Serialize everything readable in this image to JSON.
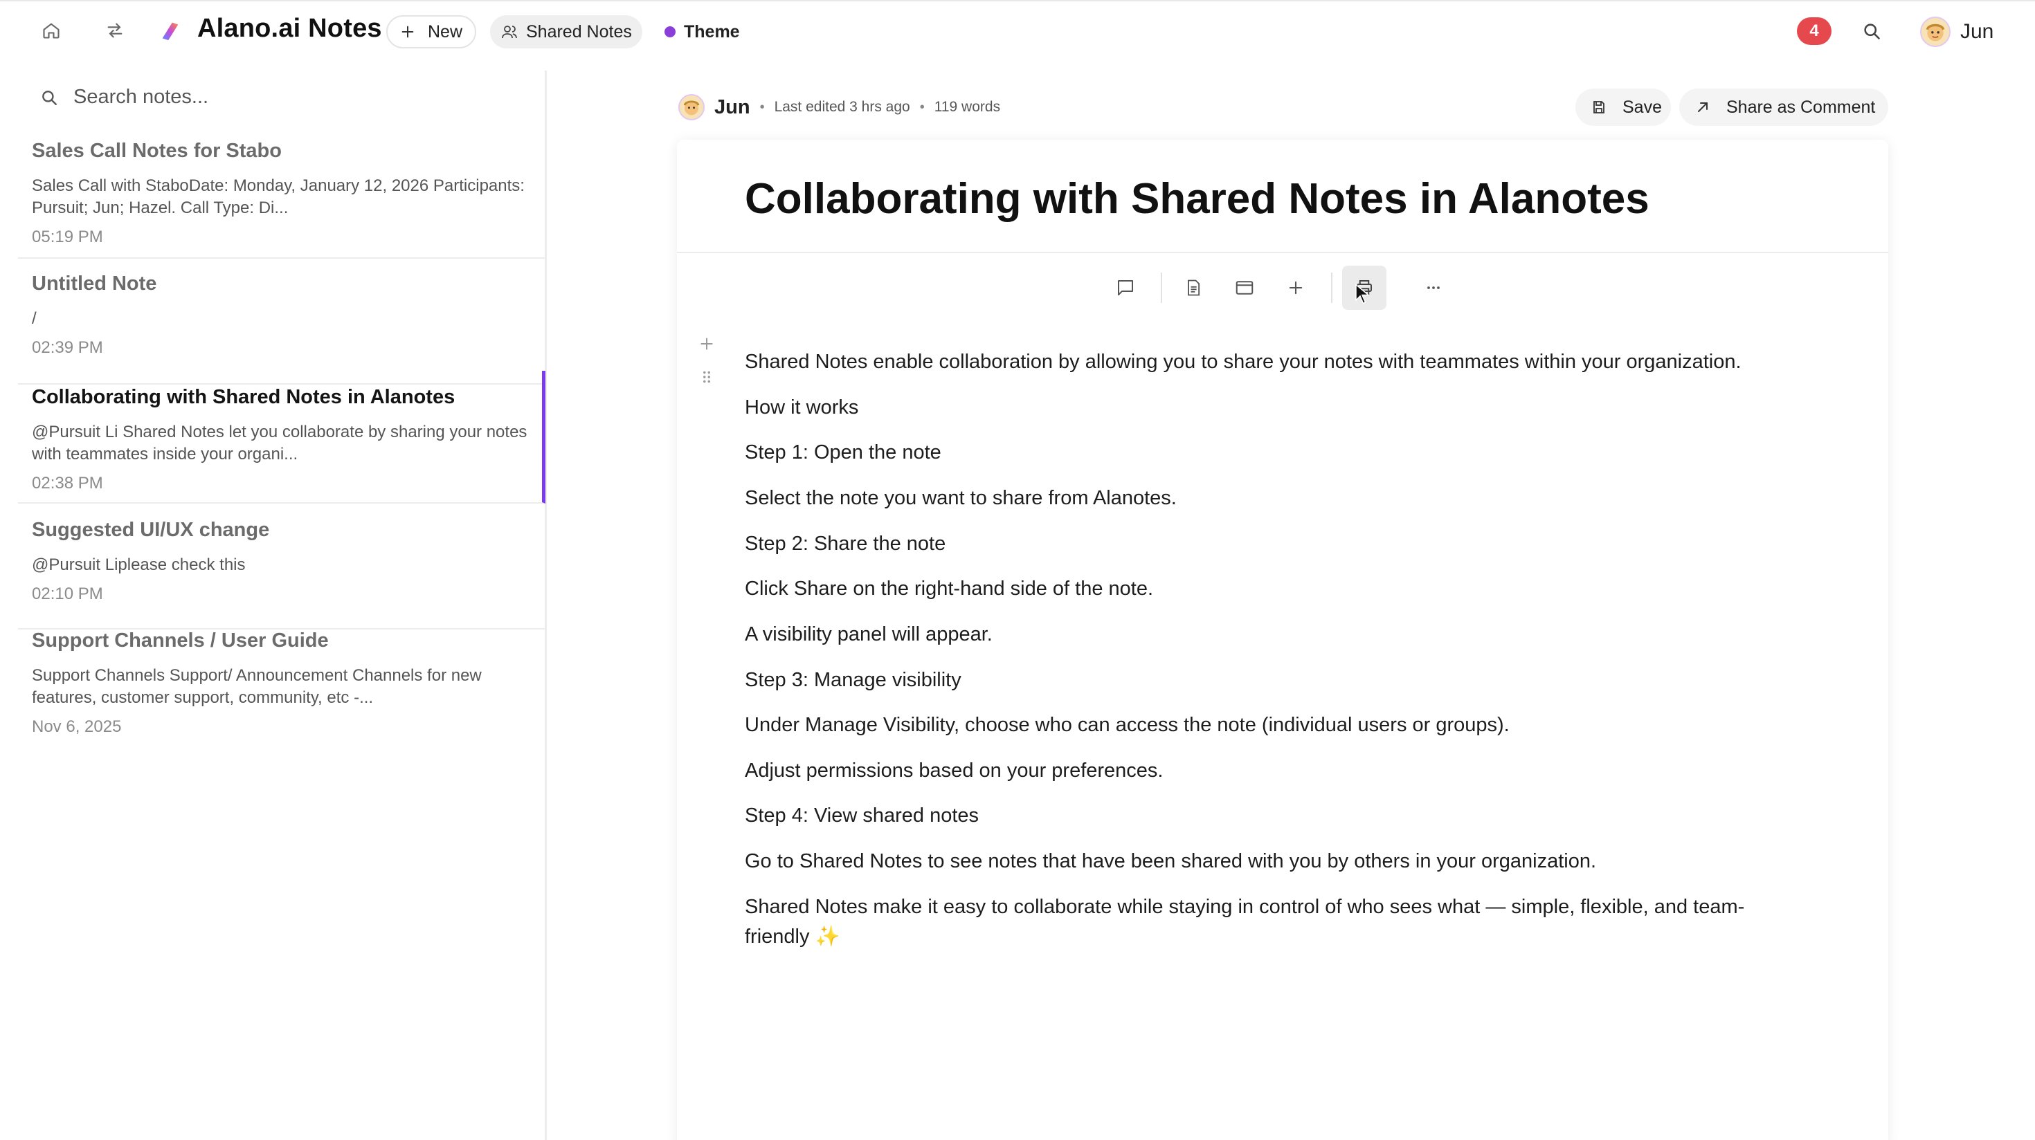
{
  "header": {
    "app_title": "Alano.ai Notes",
    "new_label": "New",
    "shared_notes_label": "Shared Notes",
    "theme_label": "Theme",
    "notification_count": "4",
    "user_name": "Jun",
    "theme_dot_color": "#8b3fd9"
  },
  "sidebar": {
    "search_placeholder": "Search notes...",
    "notes": [
      {
        "title": "Sales Call Notes for Stabo",
        "preview": "Sales Call with StaboDate: Monday, January 12, 2026 Participants: Pursuit; Jun; Hazel. Call Type: Di...",
        "time": "05:19 PM"
      },
      {
        "title": "Untitled Note",
        "preview": "/",
        "time": "02:39 PM"
      },
      {
        "title": "Collaborating with Shared Notes in Alanotes",
        "preview": "@Pursuit Li Shared Notes let you collaborate by sharing your notes with teammates inside your organi...",
        "time": "02:38 PM"
      },
      {
        "title": "Suggested UI/UX change",
        "preview": "@Pursuit Liplease check this",
        "time": "02:10 PM"
      },
      {
        "title": "Support Channels / User Guide",
        "preview": "Support Channels Support/ Announcement Channels for new features, customer support, community, etc -...",
        "time": "Nov 6, 2025"
      }
    ]
  },
  "editor": {
    "author": "Jun",
    "last_edited": "Last edited 3 hrs ago",
    "word_count": "119 words",
    "save_label": "Save",
    "share_label": "Share as Comment",
    "title": "Collaborating with Shared Notes in Alanotes",
    "paragraphs": [
      " Shared Notes enable collaboration by allowing you to share your notes with teammates within your organization.",
      "How it works",
      "Step 1: Open the note",
      "Select the note you want to share from Alanotes.",
      "Step 2: Share the note",
      "Click Share on the right-hand side of the note.",
      "A visibility panel will appear.",
      "Step 3: Manage visibility",
      "Under Manage Visibility, choose who can access the note (individual users or groups).",
      "Adjust permissions based on your preferences.",
      "Step 4: View shared notes",
      "Go to Shared Notes to see notes that have been shared with you by others in your organization.",
      "Shared Notes make it easy to collaborate while staying in control of who sees what — simple, flexible, and team-friendly ✨"
    ],
    "accent_color": "#7c3aed"
  }
}
